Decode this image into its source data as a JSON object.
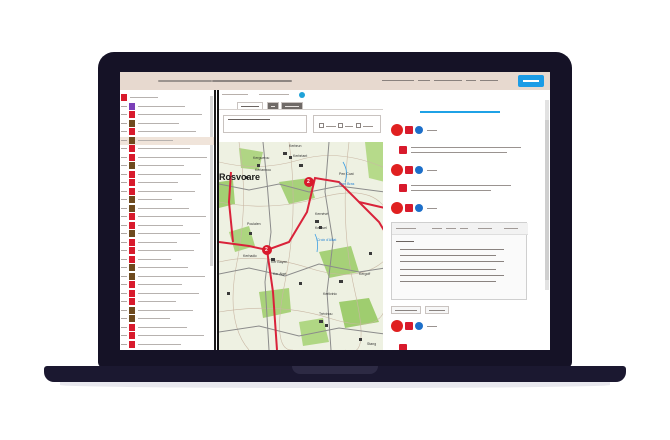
{
  "header": {
    "nav_links": [
      "",
      "",
      ""
    ],
    "action_button_label": ""
  },
  "map": {
    "labels": [
      "Rosvoare",
      "Kerbrun",
      "Kerbriant",
      "Kerlannou",
      "Poulalen",
      "Kernévé",
      "Keravel",
      "Ker Bayen",
      "Kerhadic",
      "Kerguerou",
      "Kerlivinic",
      "Trévinou",
      "Ker Aigé",
      "Kergoff",
      "Pen Coat",
      "Stang"
    ],
    "markers": [
      "2",
      "2"
    ],
    "place_blue": "Croix d'Alliat",
    "place_blue2": "Pont Bras"
  },
  "colors": {
    "accent": "#1b9ce6",
    "brand_red": "#d81a2c",
    "header_bg": "#e7d9cf",
    "laptop": "#151226"
  },
  "icons": {
    "status_circle_red": "red-circle-icon",
    "status_square_red": "red-square-icon",
    "status_circle_blue": "blue-circle-icon"
  }
}
